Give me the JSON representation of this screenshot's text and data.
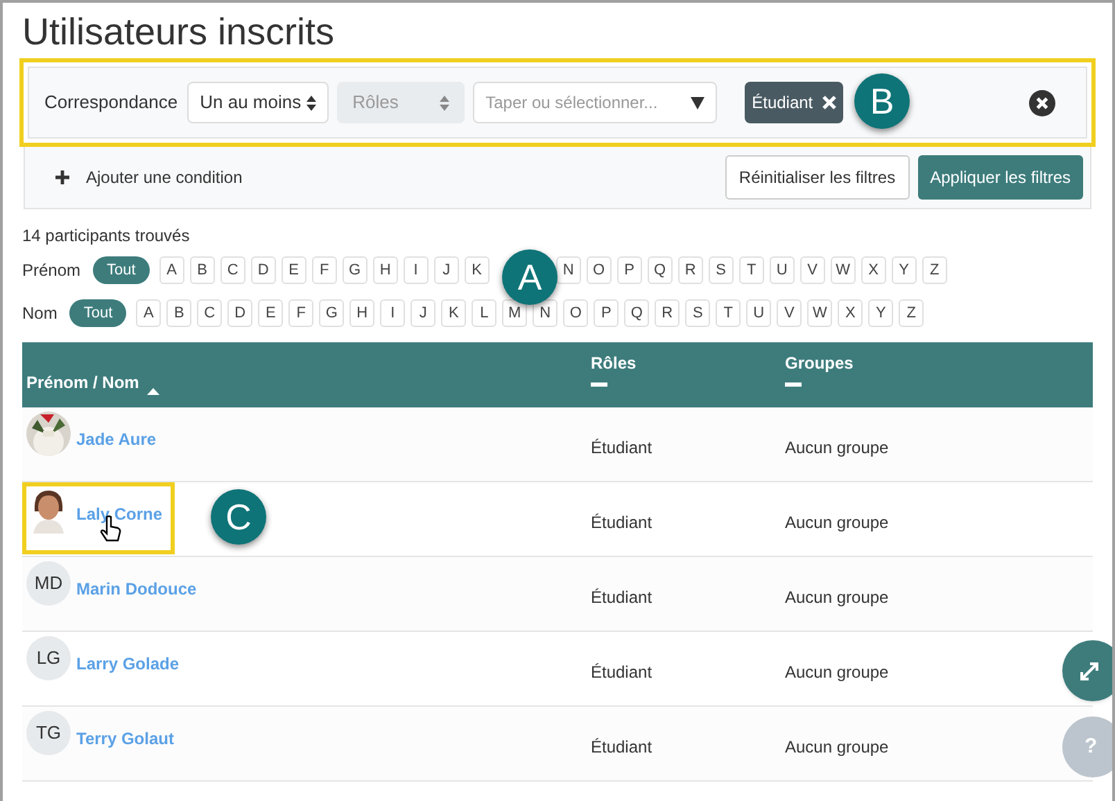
{
  "title": "Utilisateurs inscrits",
  "filter": {
    "label": "Correspondance",
    "match": "Un au moins",
    "roles_select": {
      "placeholder": "Rôles",
      "disabled": true
    },
    "search": {
      "placeholder": "Taper ou sélectionner..."
    },
    "tags": [
      "Étudiant"
    ],
    "add_condition": "Ajouter une condition",
    "buttons": [
      {
        "label": "Réinitialiser les filtres",
        "kind": "secondary"
      },
      {
        "label": "Appliquer les filtres",
        "kind": "primary"
      }
    ]
  },
  "count": "14 participants trouvés",
  "initials_bars": [
    {
      "label": "Prénom",
      "all": "Tout",
      "letters": [
        {
          "kind": "letter",
          "text": "A"
        },
        {
          "kind": "letter",
          "text": "B"
        },
        {
          "kind": "letter",
          "text": "C"
        },
        {
          "kind": "letter",
          "text": "D"
        },
        {
          "kind": "letter",
          "text": "E"
        },
        {
          "kind": "letter",
          "text": "F"
        },
        {
          "kind": "letter",
          "text": "G"
        },
        {
          "kind": "letter",
          "text": "H"
        },
        {
          "kind": "letter",
          "text": "I"
        },
        {
          "kind": "letter",
          "text": "J"
        },
        {
          "kind": "letter",
          "text": "K"
        },
        {
          "kind": "covered"
        },
        {
          "kind": "covered"
        },
        {
          "kind": "letter",
          "text": "N"
        },
        {
          "kind": "letter",
          "text": "O"
        },
        {
          "kind": "letter",
          "text": "P"
        },
        {
          "kind": "letter",
          "text": "Q"
        },
        {
          "kind": "letter",
          "text": "R"
        },
        {
          "kind": "letter",
          "text": "S"
        },
        {
          "kind": "letter",
          "text": "T"
        },
        {
          "kind": "letter",
          "text": "U"
        },
        {
          "kind": "letter",
          "text": "V"
        },
        {
          "kind": "letter",
          "text": "W"
        },
        {
          "kind": "letter",
          "text": "X"
        },
        {
          "kind": "letter",
          "text": "Y"
        },
        {
          "kind": "letter",
          "text": "Z"
        }
      ]
    },
    {
      "label": "Nom",
      "all": "Tout",
      "letters": [
        {
          "kind": "letter",
          "text": "A"
        },
        {
          "kind": "letter",
          "text": "B"
        },
        {
          "kind": "letter",
          "text": "C"
        },
        {
          "kind": "letter",
          "text": "D"
        },
        {
          "kind": "letter",
          "text": "E"
        },
        {
          "kind": "letter",
          "text": "F"
        },
        {
          "kind": "letter",
          "text": "G"
        },
        {
          "kind": "letter",
          "text": "H"
        },
        {
          "kind": "letter",
          "text": "I"
        },
        {
          "kind": "letter",
          "text": "J"
        },
        {
          "kind": "letter",
          "text": "K"
        },
        {
          "kind": "letter",
          "text": "L"
        },
        {
          "kind": "letter",
          "text": "M"
        },
        {
          "kind": "letter",
          "text": "N"
        },
        {
          "kind": "letter",
          "text": "O"
        },
        {
          "kind": "letter",
          "text": "P"
        },
        {
          "kind": "letter",
          "text": "Q"
        },
        {
          "kind": "letter",
          "text": "R"
        },
        {
          "kind": "letter",
          "text": "S"
        },
        {
          "kind": "letter",
          "text": "T"
        },
        {
          "kind": "letter",
          "text": "U"
        },
        {
          "kind": "letter",
          "text": "V"
        },
        {
          "kind": "letter",
          "text": "W"
        },
        {
          "kind": "letter",
          "text": "X"
        },
        {
          "kind": "letter",
          "text": "Y"
        },
        {
          "kind": "letter",
          "text": "Z"
        }
      ]
    }
  ],
  "table": {
    "columns": [
      "Prénom / Nom",
      "Rôles",
      "Groupes"
    ],
    "rows": [
      {
        "name": "Jade Aure",
        "kind": "picture",
        "role": "Étudiant",
        "group": "Aucun groupe",
        "highlighted": false
      },
      {
        "name": "Laly Corne",
        "kind": "figure",
        "role": "Étudiant",
        "group": "Aucun groupe",
        "highlighted": true
      },
      {
        "name": "Marin Dodouce",
        "kind": "initials",
        "initials": "MD",
        "role": "Étudiant",
        "group": "Aucun groupe",
        "highlighted": false
      },
      {
        "name": "Larry Golade",
        "kind": "initials",
        "initials": "LG",
        "role": "Étudiant",
        "group": "Aucun groupe",
        "highlighted": false
      },
      {
        "name": "Terry Golaut",
        "kind": "initials",
        "initials": "TG",
        "role": "Étudiant",
        "group": "Aucun groupe",
        "highlighted": false
      }
    ]
  },
  "callouts": [
    "A",
    "B",
    "C"
  ],
  "help_button": "?"
}
